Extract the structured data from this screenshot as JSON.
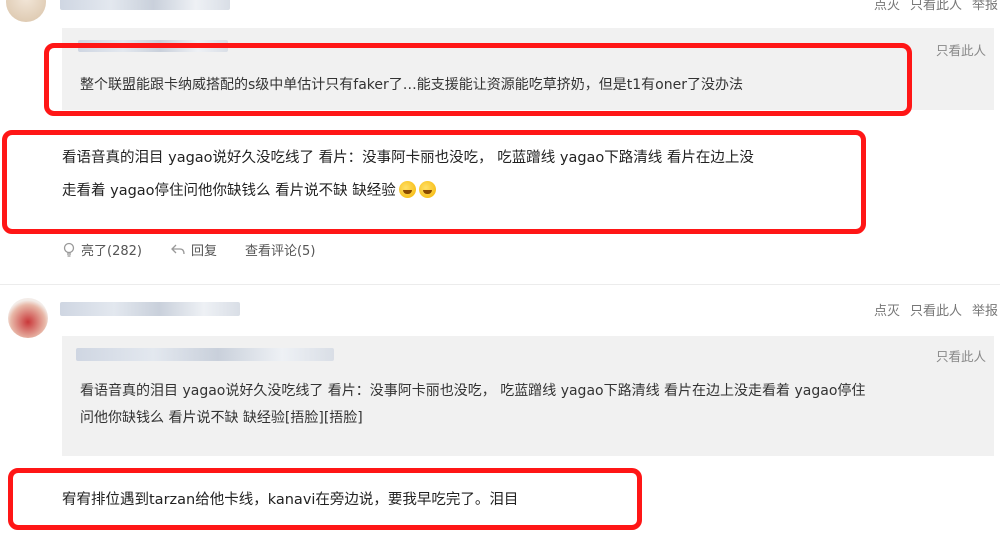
{
  "comment1": {
    "meta": {
      "downvote": "点灭",
      "only_author": "只看此人",
      "report": "举报"
    },
    "quote": {
      "only_author": "只看此人",
      "text": "整个联盟能跟卡纳威搭配的s级中单估计只有faker了…能支援能让资源能吃草挤奶，但是t1有oner了没办法"
    },
    "body_line1": "看语音真的泪目 yagao说好久没吃线了 看片：没事阿卡丽也没吃， 吃蓝蹭线 yagao下路清线 看片在边上没",
    "body_line2": "走看着 yagao停住问他你缺钱么 看片说不缺 缺经验",
    "emoji_names": [
      "laugh-cry-emoji",
      "laugh-cry-emoji"
    ],
    "actions": {
      "like": "亮了(282)",
      "reply": "回复",
      "view_comments": "查看评论(5)"
    }
  },
  "comment2": {
    "meta": {
      "downvote": "点灭",
      "only_author": "只看此人",
      "report": "举报"
    },
    "quote": {
      "only_author": "只看此人",
      "line1": "看语音真的泪目 yagao说好久没吃线了 看片：没事阿卡丽也没吃， 吃蓝蹭线 yagao下路清线 看片在边上没走看着 yagao停住",
      "line2": "问他你缺钱么 看片说不缺 缺经验[捂脸][捂脸]"
    },
    "body": "宥宥排位遇到tarzan给他卡线，kanavi在旁边说，要我早吃完了。泪目"
  },
  "colors": {
    "highlight_border": "#ff1616",
    "quote_bg": "#f1f1f1",
    "meta_text": "#777777"
  }
}
